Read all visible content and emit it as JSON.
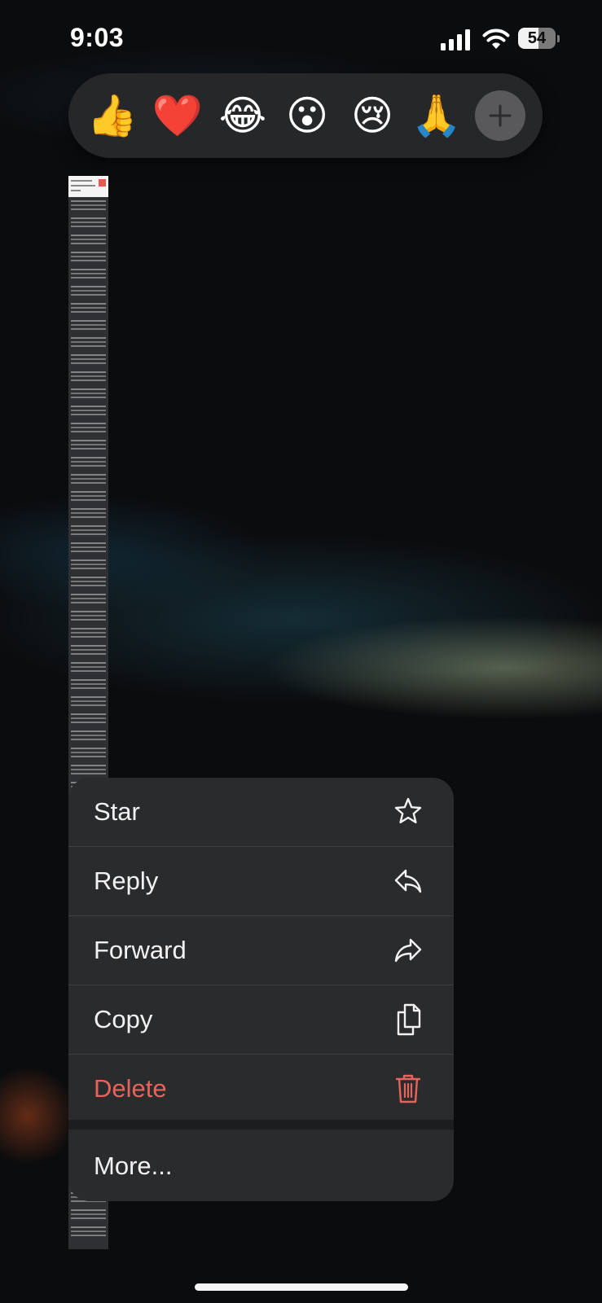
{
  "status_bar": {
    "time": "9:03",
    "battery_level": "54",
    "signal_icon": "cellular-signal-icon",
    "wifi_icon": "wifi-icon"
  },
  "reactions": [
    {
      "emoji": "👍",
      "icon": "thumbs-up-icon"
    },
    {
      "emoji": "❤️",
      "icon": "heart-icon"
    },
    {
      "emoji": "😂",
      "icon": "laughing-icon"
    },
    {
      "emoji": "😮",
      "icon": "surprised-icon"
    },
    {
      "emoji": "😢",
      "icon": "crying-icon"
    },
    {
      "emoji": "🙏",
      "icon": "praying-hands-icon"
    }
  ],
  "reaction_more_icon": "plus-icon",
  "context_menu": {
    "items": [
      {
        "label": "Star",
        "icon": "star-icon"
      },
      {
        "label": "Reply",
        "icon": "reply-icon"
      },
      {
        "label": "Forward",
        "icon": "forward-icon"
      },
      {
        "label": "Copy",
        "icon": "copy-icon"
      },
      {
        "label": "Delete",
        "icon": "trash-icon",
        "destructive": true
      }
    ],
    "more_label": "More..."
  },
  "colors": {
    "background": "#0b0c0e",
    "menu_background": "#2a2b2d",
    "destructive": "#e5645b",
    "reaction_bar": "#262729"
  }
}
